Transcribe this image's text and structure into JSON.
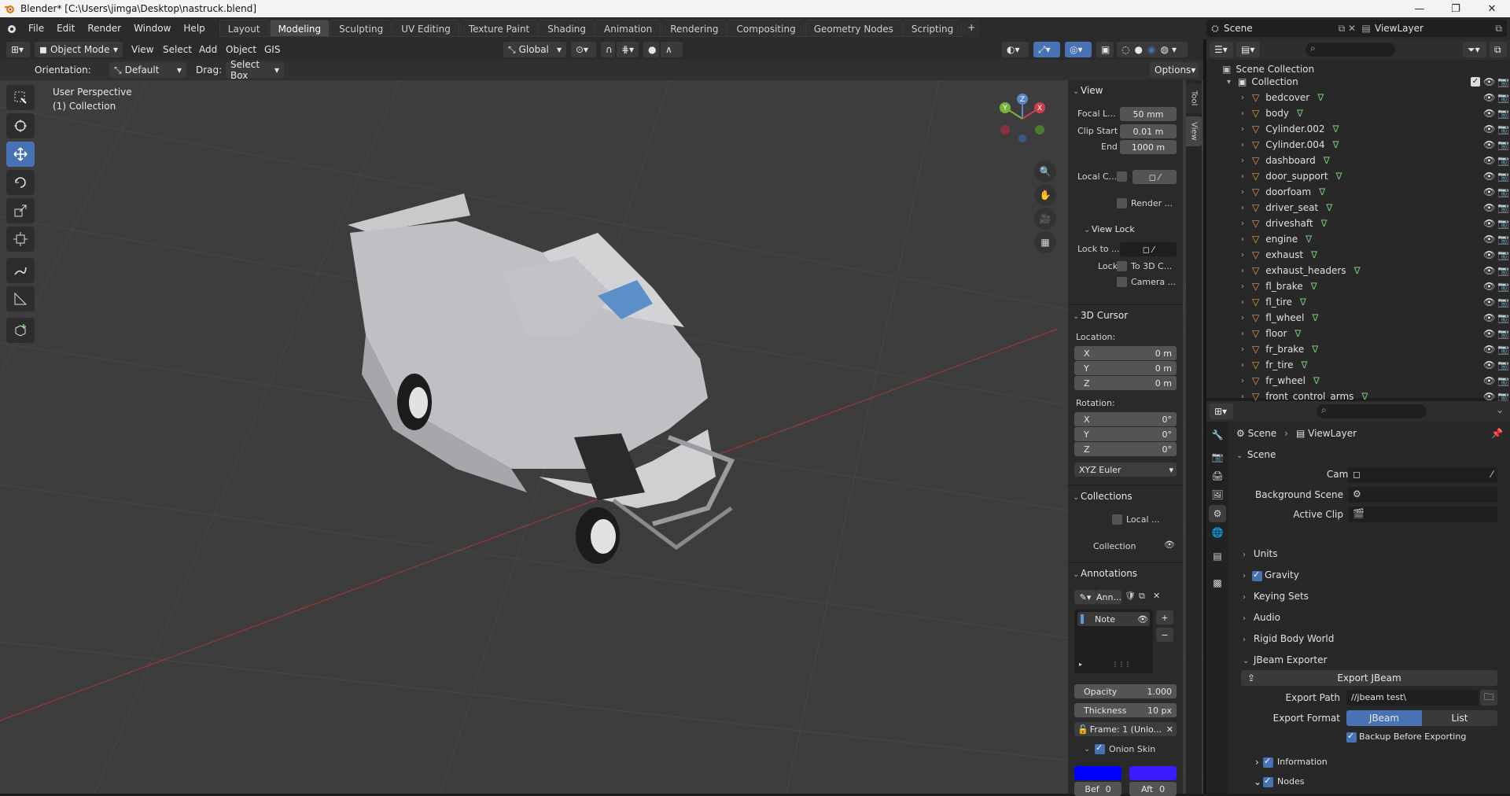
{
  "window": {
    "title": "Blender* [C:\\Users\\jimga\\Desktop\\nastruck.blend]",
    "min": "—",
    "max": "❐",
    "close": "✕"
  },
  "menu": [
    "File",
    "Edit",
    "Render",
    "Window",
    "Help"
  ],
  "workspaces": [
    "Layout",
    "Modeling",
    "Sculpting",
    "UV Editing",
    "Texture Paint",
    "Shading",
    "Animation",
    "Rendering",
    "Compositing",
    "Geometry Nodes",
    "Scripting"
  ],
  "active_workspace": "Modeling",
  "scene": {
    "label": "Scene",
    "view_layer": "ViewLayer"
  },
  "viewport_header": {
    "mode": "Object Mode",
    "menus": [
      "View",
      "Select",
      "Add",
      "Object",
      "GIS"
    ],
    "transform": "Global"
  },
  "tool_options": {
    "orientation_label": "Orientation:",
    "orientation": "Default",
    "drag_label": "Drag:",
    "drag": "Select Box",
    "options": "Options"
  },
  "viewport": {
    "perspective": "User Perspective",
    "collection": "(1) Collection"
  },
  "gizmo": {
    "x": "X",
    "y": "Y",
    "z": "Z"
  },
  "npanel": {
    "tabs": [
      "Tool",
      "View"
    ],
    "view": {
      "title": "View",
      "focal_label": "Focal L...",
      "focal": "50 mm",
      "clip_start_label": "Clip Start",
      "clip_start": "0.01 m",
      "end_label": "End",
      "end": "1000 m",
      "local_label": "Local C...",
      "render_label": "Render ..."
    },
    "view_lock": {
      "title": "View Lock",
      "lock_to_label": "Lock to ...",
      "lock_label": "Lock",
      "to3d": "To 3D C...",
      "camera": "Camera ..."
    },
    "cursor": {
      "title": "3D Cursor",
      "location_label": "Location:",
      "x_label": "X",
      "x": "0 m",
      "y_label": "Y",
      "y": "0 m",
      "z_label": "Z",
      "z": "0 m",
      "rotation_label": "Rotation:",
      "rx": "0°",
      "ry": "0°",
      "rz": "0°",
      "mode": "XYZ Euler"
    },
    "collections": {
      "title": "Collections",
      "local": "Local ...",
      "collection": "Collection"
    },
    "annotations": {
      "title": "Annotations",
      "name": "Ann...",
      "note": "Note",
      "opacity_label": "Opacity",
      "opacity": "1.000",
      "thickness_label": "Thickness",
      "thickness": "10 px",
      "frame": "Frame: 1 (Unlo...",
      "onion": "Onion Skin",
      "bef": "Bef",
      "bef_val": "0",
      "aft": "Aft",
      "aft_val": "0"
    }
  },
  "outliner": {
    "root": "Scene Collection",
    "collection": "Collection",
    "items": [
      "bedcover",
      "body",
      "Cylinder.002",
      "Cylinder.004",
      "dashboard",
      "door_support",
      "doorfoam",
      "driver_seat",
      "driveshaft",
      "engine",
      "exhaust",
      "exhaust_headers",
      "fl_brake",
      "fl_tire",
      "fl_wheel",
      "floor",
      "fr_brake",
      "fr_tire",
      "fr_wheel",
      "front_control_arms"
    ]
  },
  "properties": {
    "breadcrumb_scene": "Scene",
    "breadcrumb_layer": "ViewLayer",
    "section_scene": "Scene",
    "camera_label": "Camera",
    "bg_scene_label": "Background Scene",
    "active_clip_label": "Active Clip",
    "collapsed": [
      "Units",
      "Gravity",
      "Keying Sets",
      "Audio",
      "Rigid Body World"
    ],
    "jbeam": {
      "title": "JBeam Exporter",
      "export_btn": "Export JBeam",
      "path_label": "Export Path",
      "path": "//jbeam test\\",
      "format_label": "Export Format",
      "format_a": "JBeam",
      "format_b": "List",
      "backup": "Backup Before Exporting",
      "information": "Information",
      "nodes": "Nodes"
    }
  },
  "colors": {
    "accent": "#4772b3",
    "viewport": "#3d3d3d",
    "x_axis": "#b33a3a"
  }
}
